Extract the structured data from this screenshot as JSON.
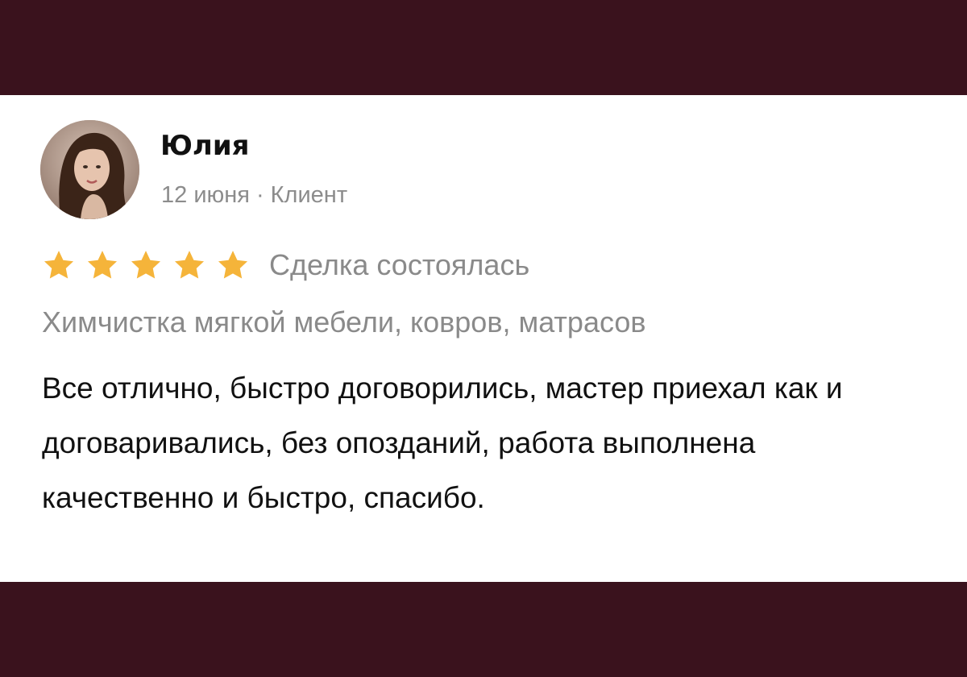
{
  "colors": {
    "background": "#3a121d",
    "card": "#ffffff",
    "star": "#f5b43a",
    "muted_text": "#8a8a8a",
    "body_text": "#111111"
  },
  "review": {
    "author_name": "Юлия",
    "date": "12 июня",
    "separator": "·",
    "role": "Клиент",
    "rating": 5,
    "rating_max": 5,
    "deal_status": "Сделка состоялась",
    "service": "Химчистка мягкой мебели, ковров, матрасов",
    "text": "Все отлично, быстро договорились, мастер приехал как и договаривались, без опозданий, работа выполнена качественно и быстро, спасибо."
  },
  "icons": {
    "avatar": "user-avatar-photo",
    "star": "star-icon"
  }
}
